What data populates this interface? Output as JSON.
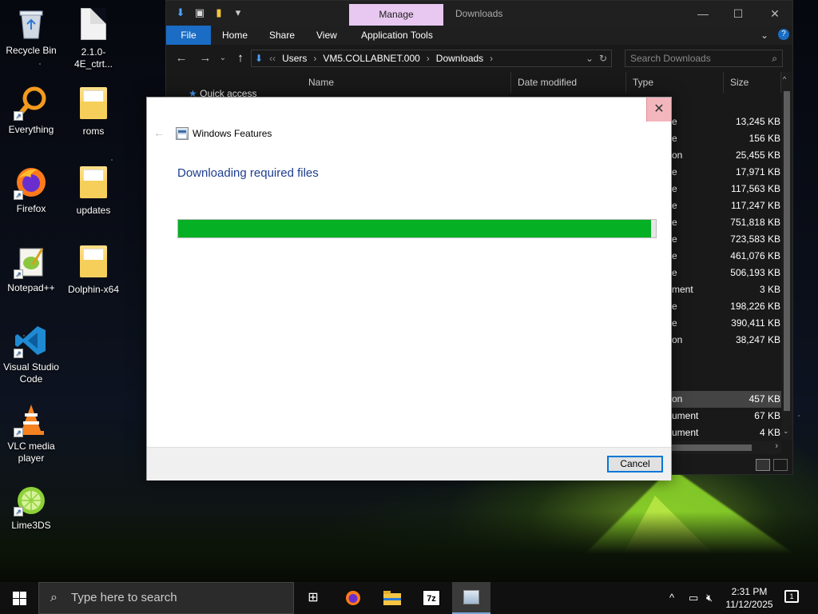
{
  "desktop": {
    "icons": [
      {
        "label": "Recycle Bin",
        "icon": "recycle-bin-icon"
      },
      {
        "label": "2.1.0-4E_ctrt...",
        "icon": "document-file-icon"
      },
      {
        "label": "Everything",
        "icon": "everything-search-icon"
      },
      {
        "label": "roms",
        "icon": "folder-icon"
      },
      {
        "label": "Firefox",
        "icon": "firefox-icon"
      },
      {
        "label": "updates",
        "icon": "folder-icon"
      },
      {
        "label": "Notepad++",
        "icon": "notepad-plus-plus-icon"
      },
      {
        "label": "Dolphin-x64",
        "icon": "folder-icon"
      },
      {
        "label": "Visual Studio Code",
        "icon": "vscode-icon"
      },
      {
        "label": "VLC media player",
        "icon": "vlc-icon"
      },
      {
        "label": "Lime3DS",
        "icon": "lime3ds-icon"
      }
    ]
  },
  "explorer": {
    "manage_tab": "Manage",
    "title": "Downloads",
    "ribbon": {
      "file": "File",
      "home": "Home",
      "share": "Share",
      "view": "View",
      "application_tools": "Application Tools"
    },
    "address": {
      "crumbs": [
        "Users",
        "VM5.COLLABNET.000",
        "Downloads"
      ]
    },
    "search_placeholder": "Search Downloads",
    "nav_quick_access": "Quick access",
    "columns": {
      "name": "Name",
      "date_modified": "Date modified",
      "type": "Type",
      "size": "Size"
    },
    "rows": [
      {
        "type_fragment": "e",
        "size": "13,245 KB"
      },
      {
        "type_fragment": "e",
        "size": "156 KB"
      },
      {
        "type_fragment": "on",
        "size": "25,455 KB"
      },
      {
        "type_fragment": "e",
        "size": "17,971 KB"
      },
      {
        "type_fragment": "e",
        "size": "117,563 KB"
      },
      {
        "type_fragment": "e",
        "size": "117,247 KB"
      },
      {
        "type_fragment": "e",
        "size": "751,818 KB"
      },
      {
        "type_fragment": "e",
        "size": "723,583 KB"
      },
      {
        "type_fragment": "e",
        "size": "461,076 KB"
      },
      {
        "type_fragment": "e",
        "size": "506,193 KB"
      },
      {
        "type_fragment": "ment",
        "size": "3 KB"
      },
      {
        "type_fragment": "e",
        "size": "198,226 KB"
      },
      {
        "type_fragment": "e",
        "size": "390,411 KB"
      },
      {
        "type_fragment": "on",
        "size": "38,247 KB"
      }
    ],
    "rows_lower": [
      {
        "type_fragment": "on",
        "size": "457 KB",
        "selected": true
      },
      {
        "type_fragment": "ument",
        "size": "67 KB",
        "selected": false
      },
      {
        "type_fragment": "ument",
        "size": "4 KB",
        "selected": false
      }
    ]
  },
  "dialog": {
    "title": "Windows Features",
    "heading": "Downloading required files",
    "progress_percent": 99,
    "cancel_label": "Cancel"
  },
  "taskbar": {
    "search_placeholder": "Type here to search",
    "apps": [
      "task-view-icon",
      "firefox-icon",
      "file-explorer-icon",
      "7zip-icon",
      "windows-features-icon"
    ],
    "time": "2:31 PM",
    "date": "11/12/2025",
    "notification_count": "1"
  },
  "colors": {
    "progress_fill": "#06b025",
    "heading": "#1e3d8f",
    "file_tab": "#1a6cc4",
    "manage_tab": "#e8c8f0"
  }
}
